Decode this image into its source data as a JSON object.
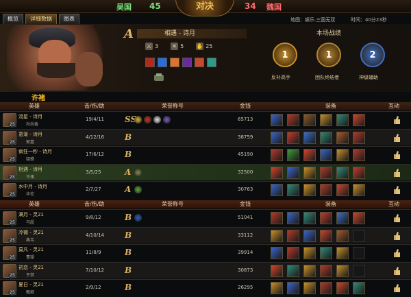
{
  "header": {
    "team_left": "吴国",
    "score_left": "45",
    "logo_text": "对决",
    "score_right": "34",
    "team_right": "魏国",
    "map_label": "地图：娱乐.三国无双",
    "time_label": "时间：40分23秒"
  },
  "tabs": [
    {
      "label": "概览",
      "active": false
    },
    {
      "label": "详细数据",
      "active": true
    },
    {
      "label": "图表",
      "active": false
    }
  ],
  "hero": {
    "display_name": "许褚",
    "grade": "A",
    "player": "相遇 - 诗月",
    "kills": "3",
    "deaths": "5",
    "assists": "25",
    "skill_colors": [
      "#b22a1a",
      "#2b6fd6",
      "#e0732b",
      "#6a2a9c",
      "#c6492c",
      "#2e9a8a"
    ]
  },
  "battle": {
    "title": "本场战绩",
    "medals": [
      {
        "label": "反补高手",
        "value": "1",
        "color": "#c8902a"
      },
      {
        "label": "团队终结者",
        "value": "1",
        "color": "#b58430"
      },
      {
        "label": "神级辅助",
        "value": "2",
        "color": "#3c6fc6"
      }
    ]
  },
  "table": {
    "cols": {
      "hero": "英雄",
      "kda": "击/伤/助",
      "honor": "荣誉称号",
      "gold": "金钱",
      "equip": "装备",
      "interact": "互动"
    },
    "team1": [
      {
        "player": "流星 - 诗月",
        "hero": "孙尚香",
        "level": "25",
        "kda": "19/4/11",
        "grade": "SS",
        "gold": "65713",
        "self": false,
        "honors": [
          "#d9b23c",
          "#c23c2c",
          "#e8e8e8",
          "#7a5cc0"
        ],
        "items": [
          "#3a66c8",
          "#b33a2a",
          "#8a5a2c",
          "#c8902a",
          "#2f8a7a",
          "#d0452c"
        ]
      },
      {
        "player": "意渐 - 诗月",
        "hero": "郭嘉",
        "level": "25",
        "kda": "4/12/16",
        "grade": "B",
        "gold": "38759",
        "self": false,
        "honors": [],
        "items": [
          "#3a66c8",
          "#c23c2c",
          "#3b6fc9",
          "#2f8a7a",
          "#a85a2c",
          "#b33a2a"
        ]
      },
      {
        "player": "疯狂一秒 - 诗月",
        "hero": "貂蝉",
        "level": "25",
        "kda": "17/6/12",
        "grade": "B",
        "gold": "45190",
        "self": false,
        "honors": [],
        "items": [
          "#b33a2a",
          "#3f9a3c",
          "#d0452c",
          "#3a66c8",
          "#c8902a",
          "#b33a2a"
        ]
      },
      {
        "player": "相遇 - 诗月",
        "hero": "许褚",
        "level": "25",
        "kda": "3/5/25",
        "grade": "A",
        "gold": "32500",
        "self": true,
        "honors": [
          "#8a8a5a"
        ],
        "items": [
          "#d0452c",
          "#3a66c8",
          "#c8902a",
          "#b33a2a",
          "#2f8a7a",
          "#c23c2c"
        ]
      },
      {
        "player": "水中月 - 诗月",
        "hero": "华佗",
        "level": "25",
        "kda": "2/7/27",
        "grade": "A",
        "gold": "30763",
        "self": false,
        "honors": [
          "#5fa83c"
        ],
        "items": [
          "#3a66c8",
          "#2f8a7a",
          "#c8902a",
          "#b33a2a",
          "#d0452c",
          "#c8902a"
        ]
      }
    ],
    "team2": [
      {
        "player": "满月 - 灵21",
        "hero": "马超",
        "level": "25",
        "kda": "9/8/12",
        "grade": "B",
        "gold": "51041",
        "self": false,
        "honors": [
          "#2f5fbf"
        ],
        "items": [
          "#b33a2a",
          "#3a66c8",
          "#2f8a7a",
          "#c23c2c",
          "#3b6fc9",
          "#d0452c"
        ]
      },
      {
        "player": "冷微 - 灵21",
        "hero": "典韦",
        "level": "25",
        "kda": "4/10/14",
        "grade": "B",
        "gold": "33112",
        "self": false,
        "honors": [],
        "items": [
          "#c8902a",
          "#b33a2a",
          "#3a66c8",
          "#d0452c",
          "#a85a2c",
          "empty"
        ]
      },
      {
        "player": "莫凡 - 灵21",
        "hero": "曹操",
        "level": "25",
        "kda": "11/8/9",
        "grade": "B",
        "gold": "39914",
        "self": false,
        "honors": [],
        "items": [
          "#3a66c8",
          "#b33a2a",
          "#c8902a",
          "#2f8a7a",
          "#c8902a",
          "empty"
        ]
      },
      {
        "player": "初恋 - 灵21",
        "hero": "于禁",
        "level": "25",
        "kda": "7/10/12",
        "grade": "B",
        "gold": "30873",
        "self": false,
        "honors": [],
        "items": [
          "#d0452c",
          "#2f8a7a",
          "#c8902a",
          "#b33a2a",
          "#c8902a",
          "empty"
        ]
      },
      {
        "player": "夏日 - 灵21",
        "hero": "甄姬",
        "level": "25",
        "kda": "2/9/12",
        "grade": "B",
        "gold": "26295",
        "self": false,
        "honors": [],
        "items": [
          "#c8902a",
          "#3a66c8",
          "#c8902a",
          "#b33a2a",
          "#d0452c",
          "#2f8a7a"
        ]
      }
    ]
  }
}
